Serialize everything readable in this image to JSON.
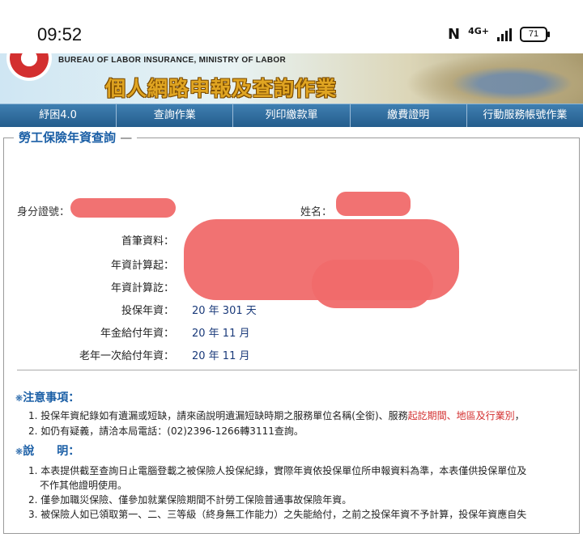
{
  "status_bar": {
    "time": "09:52",
    "network": "4G+",
    "battery": "71"
  },
  "banner": {
    "bureau_en": "BUREAU OF LABOR INSURANCE, MINISTRY OF LABOR",
    "title": "個人網路申報及查詢作業"
  },
  "nav": [
    "紓困4.0",
    "查詢作業",
    "列印繳款單",
    "繳費證明",
    "行動服務帳號作業"
  ],
  "section_title": "勞工保險年資查詢",
  "person": {
    "id_label": "身分證號：",
    "name_label": "姓名："
  },
  "details": [
    {
      "label": "首筆資料：",
      "value": ""
    },
    {
      "label": "年資計算起：",
      "value": ""
    },
    {
      "label": "年資計算訖：",
      "value": ""
    },
    {
      "label": "投保年資：",
      "value": "20 年 301 天"
    },
    {
      "label": "年金給付年資：",
      "value": "20 年 11 月"
    },
    {
      "label": "老年一次給付年資：",
      "value": "20 年 11 月"
    }
  ],
  "notices": {
    "heading": "注意事項：",
    "items": [
      {
        "prefix": "1. 投保年資紀錄如有遺漏或短缺，請來函說明遺漏短缺時期之服務單位名稱(全銜)、服務",
        "highlight": "起訖期間、地區及行業別",
        "suffix": "，"
      },
      {
        "text": "2. 如仍有疑義，請洽本局電話：(02)2396-1266轉3111查詢。"
      }
    ]
  },
  "explain": {
    "heading": "說　　明：",
    "items": [
      "1. 本表提供截至查詢日止電腦登載之被保險人投保紀錄，實際年資依投保單位所申報資料為準，本表僅供投保單位及",
      "不作其他證明使用。",
      "2. 僅參加職災保險、僅參加就業保險期間不計勞工保險普通事故保險年資。",
      "3. 被保險人如已領取第一、二、三等級（終身無工作能力）之失能給付，之前之投保年資不予計算，投保年資應自失"
    ]
  }
}
